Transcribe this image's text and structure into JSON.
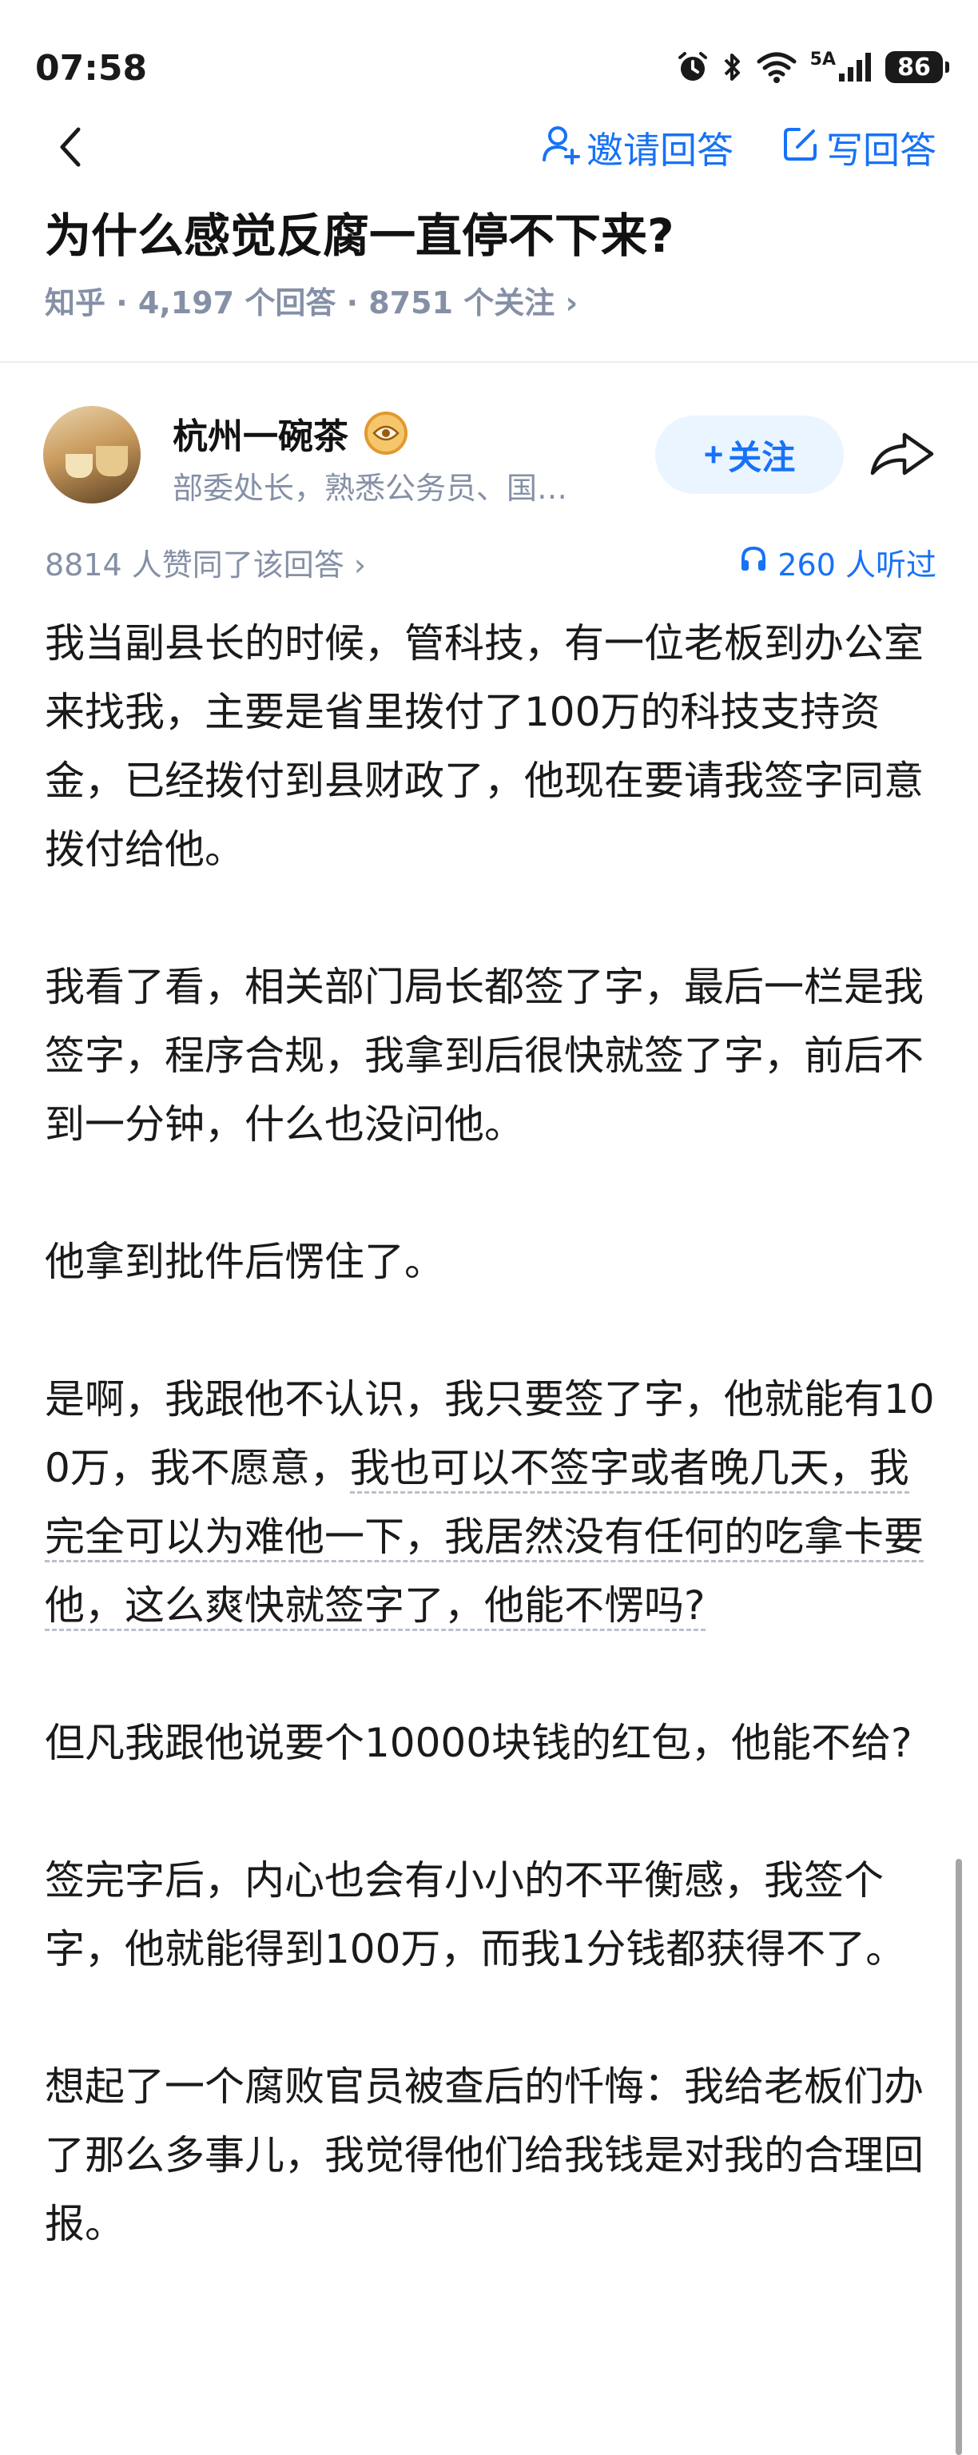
{
  "status_bar": {
    "time": "07:58",
    "network": "5A",
    "battery": "86"
  },
  "nav": {
    "invite_label": "邀请回答",
    "write_label": "写回答"
  },
  "question": {
    "title": "为什么感觉反腐一直停不下来?",
    "source": "知乎",
    "answers": "4,197 个回答",
    "followers": "8751 个关注",
    "meta_separator": " · ",
    "chevron": "›"
  },
  "author": {
    "name": "杭州一碗茶",
    "description": "部委处长，熟悉公务员、国…",
    "follow_label": "关注",
    "follow_plus": "+"
  },
  "stats": {
    "likes": "8814 人赞同了该回答 ›",
    "listens": "260 人听过"
  },
  "content": {
    "p1": "我当副县长的时候，管科技，有一位老板到办公室来找我，主要是省里拨付了100万的科技支持资金，已经拨付到县财政了，他现在要请我签字同意拨付给他。",
    "p2": "我看了看，相关部门局长都签了字，最后一栏是我签字，程序合规，我拿到后很快就签了字，前后不到一分钟，什么也没问他。",
    "p3": "他拿到批件后愣住了。",
    "p4_plain": "是啊，我跟他不认识，我只要签了字，他就能有100万，我不愿意，",
    "p4_dashed": "我也可以不签字或者晚几天，我完全可以为难他一下，我居然没有任何的吃拿卡要他，这么爽快就签字了，他能不愣吗?",
    "p5": "但凡我跟他说要个10000块钱的红包，他能不给?",
    "p6": "签完字后，内心也会有小小的不平衡感，我签个字，他就能得到100万，而我1分钱都获得不了。",
    "p7": "想起了一个腐败官员被查后的忏悔：我给老板们办了那么多事儿，我觉得他们给我钱是对我的合理回报。"
  },
  "icons": {
    "back": "chevron-left-icon",
    "invite": "person-plus-icon",
    "write": "edit-icon",
    "badge": "eye-badge-icon",
    "share": "share-arrow-icon",
    "listen": "headphones-icon"
  },
  "colors": {
    "accent": "#1772f6",
    "meta_gray": "#8590a6",
    "follow_bg": "#ebf5ff"
  }
}
